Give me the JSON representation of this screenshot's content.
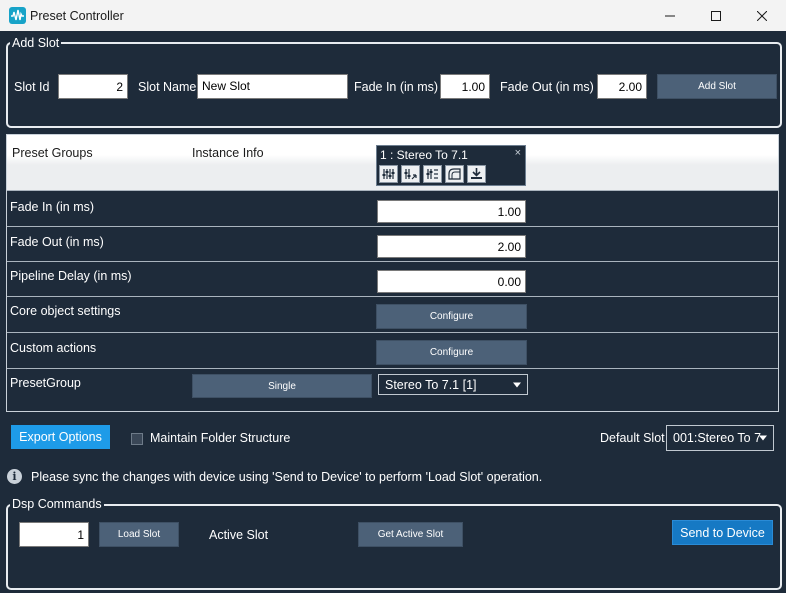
{
  "window": {
    "title": "Preset Controller"
  },
  "add_slot": {
    "legend": "Add Slot",
    "slot_id_label": "Slot Id",
    "slot_id_value": "2",
    "slot_name_label": "Slot Name",
    "slot_name_value": "New Slot",
    "fade_in_label": "Fade In (in ms)",
    "fade_in_value": "1.00",
    "fade_out_label": "Fade Out (in ms)",
    "fade_out_value": "2.00",
    "add_button": "Add Slot"
  },
  "grid": {
    "headers": [
      "Preset Groups",
      "Instance Info"
    ],
    "instance": {
      "title": "1 : Stereo To 7.1",
      "close": "×",
      "tools": [
        "eq-sliders-icon",
        "mixer-icon",
        "channel-map-icon",
        "curve-icon",
        "download-icon"
      ]
    },
    "rows": {
      "fade_in": {
        "label": "Fade In (in ms)",
        "value": "1.00"
      },
      "fade_out": {
        "label": "Fade Out (in ms)",
        "value": "2.00"
      },
      "pipeline_delay": {
        "label": "Pipeline Delay (in ms)",
        "value": "0.00"
      },
      "core_settings": {
        "label": "Core object settings",
        "button": "Configure"
      },
      "custom_actions": {
        "label": "Custom actions",
        "button": "Configure"
      },
      "preset_group": {
        "label": "PresetGroup",
        "mode_button": "Single",
        "selected": "Stereo To 7.1 [1]"
      }
    }
  },
  "export": {
    "button": "Export Options",
    "maintain_folder_label": "Maintain Folder Structure",
    "maintain_folder_checked": false,
    "default_slot_label": "Default Slot",
    "default_slot_value": "001:Stereo To 7"
  },
  "info": {
    "message": "Please sync the changes with device using 'Send to Device' to perform 'Load Slot' operation."
  },
  "dsp": {
    "legend": "Dsp Commands",
    "slot_value": "1",
    "load_button": "Load Slot",
    "active_slot_label": "Active Slot",
    "get_active_button": "Get Active Slot",
    "send_button": "Send to Device"
  },
  "colors": {
    "background": "#1e2b3a",
    "accent_blue": "#1e9be8",
    "send_blue": "#1679c4",
    "button_slate": "#4c6178"
  }
}
